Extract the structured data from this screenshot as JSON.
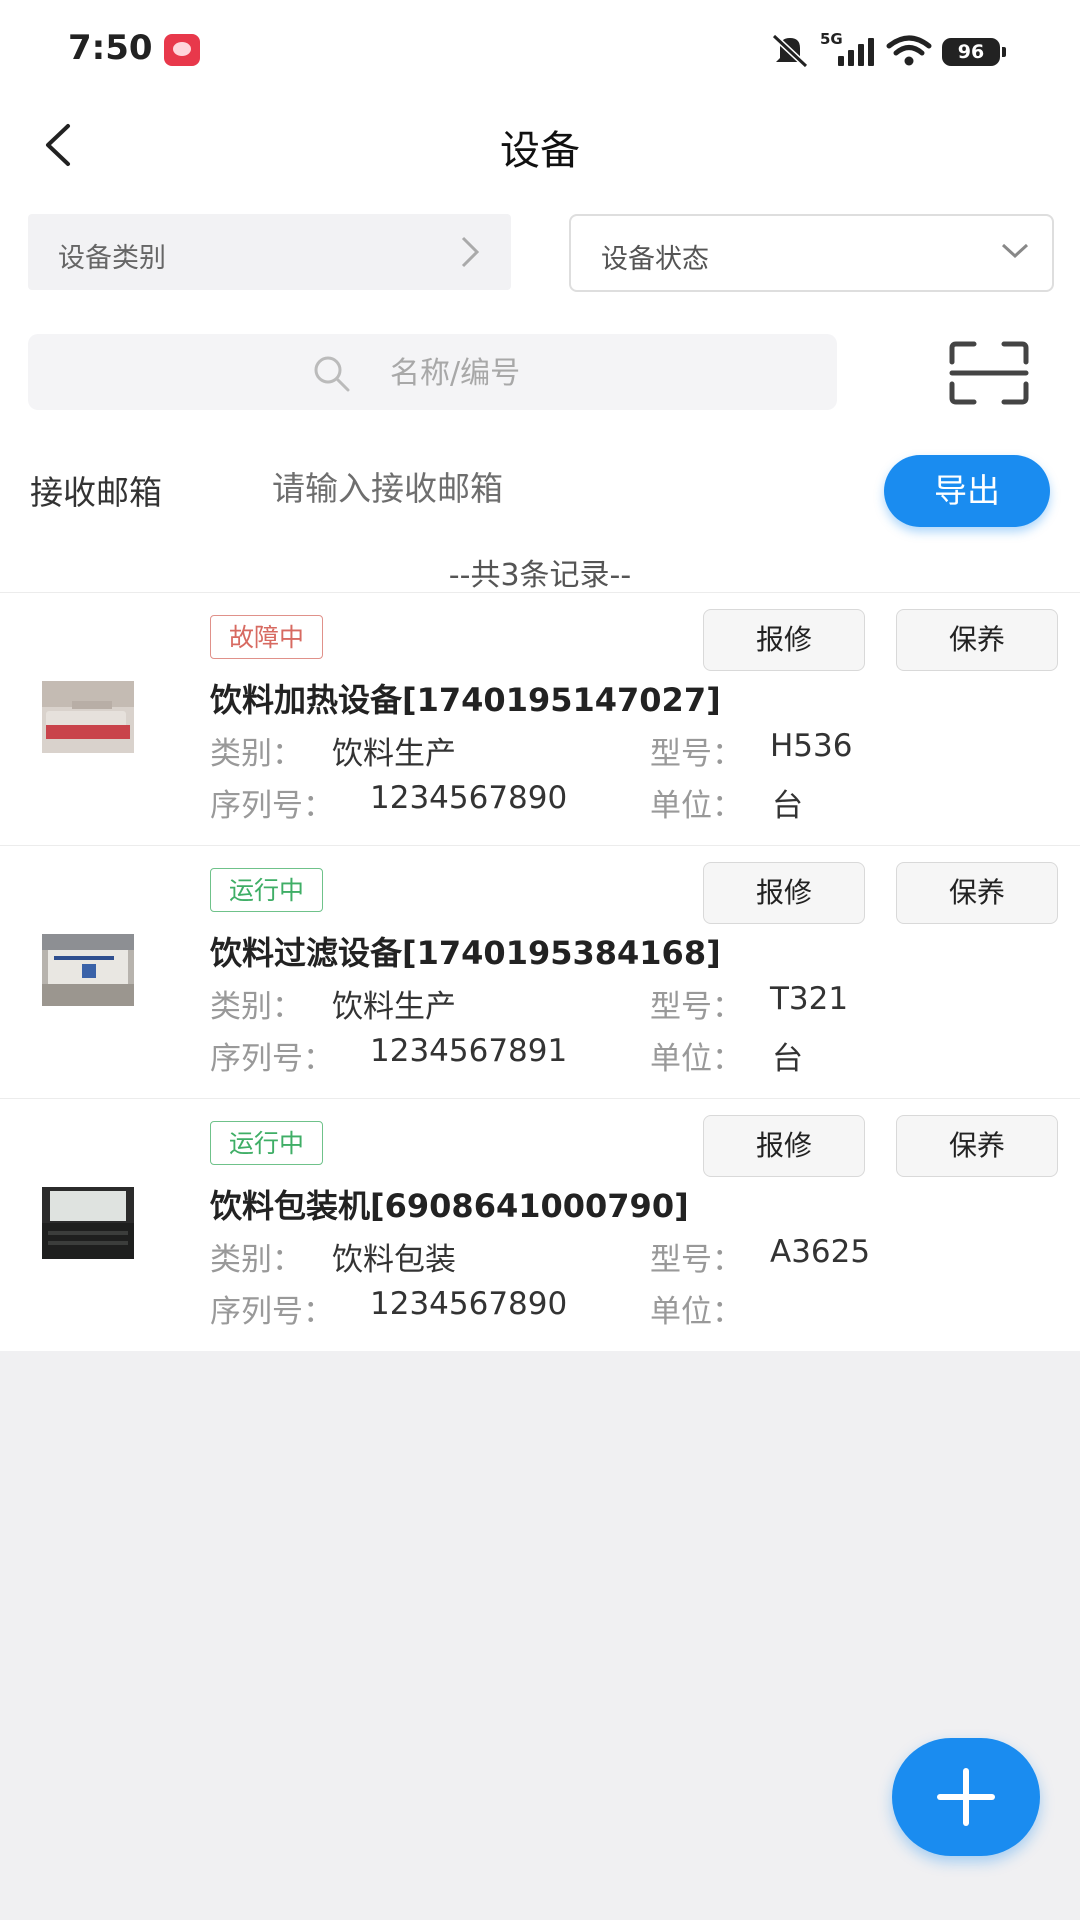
{
  "status_bar": {
    "time": "7:50",
    "network": "5G",
    "battery": "96"
  },
  "header": {
    "title": "设备"
  },
  "filters": {
    "category_label": "设备类别",
    "status_label": "设备状态"
  },
  "search": {
    "placeholder": "名称/编号"
  },
  "email": {
    "label": "接收邮箱",
    "placeholder": "请输入接收邮箱",
    "export_label": "导出"
  },
  "record_count": "--共3条记录--",
  "actions": {
    "repair": "报修",
    "maintain": "保养"
  },
  "field_labels": {
    "category": "类别：",
    "model": "型号：",
    "serial": "序列号：",
    "unit": "单位："
  },
  "devices": [
    {
      "status": "故障中",
      "name": "饮料加热设备[1740195147027]",
      "category": "饮料生产",
      "model": "H536",
      "serial": "1234567890",
      "unit": "台"
    },
    {
      "status": "运行中",
      "name": "饮料过滤设备[1740195384168]",
      "category": "饮料生产",
      "model": "T321",
      "serial": "1234567891",
      "unit": "台"
    },
    {
      "status": "运行中",
      "name": "饮料包装机[6908641000790]",
      "category": "饮料包装",
      "model": "A3625",
      "serial": "1234567890",
      "unit": ""
    }
  ],
  "colors": {
    "accent": "#1a8cf0",
    "fault": "#d76a61",
    "running": "#3fae66"
  }
}
